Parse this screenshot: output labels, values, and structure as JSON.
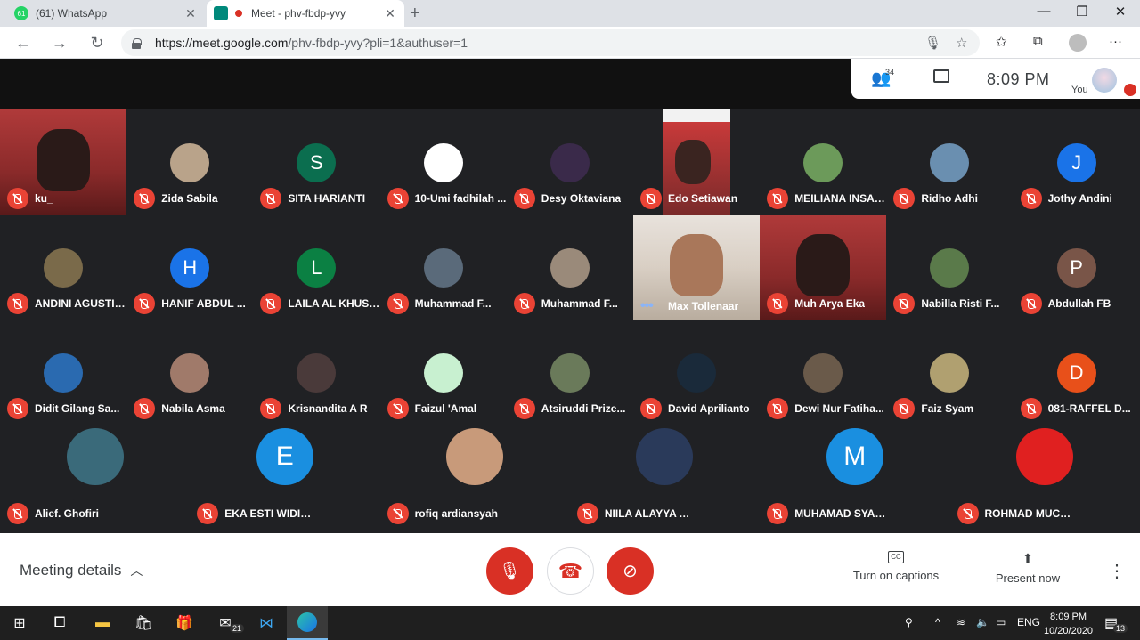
{
  "browser": {
    "tabs": [
      {
        "title": "(61) WhatsApp",
        "favicon_text": "61",
        "favicon_color": "#25d366"
      },
      {
        "title": "Meet - phv-fbdp-yvy",
        "favicon_color": "#00897b"
      }
    ],
    "url_host": "https://meet.google.com",
    "url_rest": "/phv-fbdp-yvy?pli=1&authuser=1"
  },
  "topbar": {
    "participant_count": "34",
    "time": "8:09  PM",
    "you_label": "You"
  },
  "participants": [
    {
      "name": "ku_",
      "type": "video"
    },
    {
      "name": "Zida Sabila",
      "avatar_color": "#b9a38a"
    },
    {
      "name": "SITA HARIANTI",
      "initial": "S",
      "avatar_color": "#0b6e4f"
    },
    {
      "name": "10-Umi fadhilah ...",
      "avatar_color": "#ffffff"
    },
    {
      "name": "Desy Oktaviana",
      "avatar_color": "#3a2a4a"
    },
    {
      "name": "Edo Setiawan",
      "type": "video-small"
    },
    {
      "name": "MEILIANA INSANI...",
      "avatar_color": "#6c9a5a"
    },
    {
      "name": "Ridho Adhi",
      "avatar_color": "#6a8fb0"
    },
    {
      "name": "Jothy Andini",
      "initial": "J",
      "avatar_color": "#1a73e8"
    },
    {
      "name": "ANDINI AGUSTINA",
      "avatar_color": "#7a6a4a"
    },
    {
      "name": "HANIF ABDUL ...",
      "initial": "H",
      "avatar_color": "#1a73e8"
    },
    {
      "name": "LAILA AL KHUSNA",
      "initial": "L",
      "avatar_color": "#0b8043"
    },
    {
      "name": "Muhammad F...",
      "avatar_color": "#5a6a7a"
    },
    {
      "name": "Muhammad F...",
      "avatar_color": "#9a8a7a"
    },
    {
      "name": "Max Tollenaar",
      "type": "video-speaking"
    },
    {
      "name": "Muh Arya Eka",
      "type": "video"
    },
    {
      "name": "Nabilla Risti F...",
      "avatar_color": "#5a7a4a"
    },
    {
      "name": "Abdullah FB",
      "initial": "P",
      "avatar_color": "#795548"
    },
    {
      "name": "Didit Gilang Sa...",
      "avatar_color": "#2a6ab0"
    },
    {
      "name": "Nabila Asma",
      "avatar_color": "#a07a6a"
    },
    {
      "name": "Krisnandita A R",
      "avatar_color": "#4a3a3a"
    },
    {
      "name": "Faizul 'Amal",
      "avatar_color": "#c8f0d0"
    },
    {
      "name": "Atsiruddi Prize...",
      "avatar_color": "#6a7a5a"
    },
    {
      "name": "David Aprilianto",
      "avatar_color": "#1a2a3a"
    },
    {
      "name": "Dewi Nur Fatiha...",
      "avatar_color": "#6a5a4a"
    },
    {
      "name": "Faiz Syam",
      "avatar_color": "#b0a070"
    },
    {
      "name": "081-RAFFEL D...",
      "initial": "D",
      "avatar_color": "#e8501a"
    },
    {
      "name": "Alief. Ghofiri",
      "avatar_color": "#3a6a7a"
    },
    {
      "name": "EKA ESTI WIDIYASTUTI",
      "initial": "E",
      "avatar_color": "#1a8fe0"
    },
    {
      "name": "rofiq ardiansyah",
      "avatar_color": "#c89a7a"
    },
    {
      "name": "NIILA ALAYYA ADILLA",
      "avatar_color": "#2a3a5a"
    },
    {
      "name": "MUHAMAD SYAHRUL GUFRON",
      "initial": "M",
      "avatar_color": "#1a8fe0"
    },
    {
      "name": "ROHMAD MUCHAROM",
      "avatar_color": "#e02020"
    }
  ],
  "bottombar": {
    "meeting_details": "Meeting details",
    "captions": "Turn on captions",
    "present": "Present now"
  },
  "taskbar": {
    "mail_badge": "21",
    "lang": "ENG",
    "time": "8:09 PM",
    "date": "10/20/2020",
    "notif_count": "13"
  }
}
